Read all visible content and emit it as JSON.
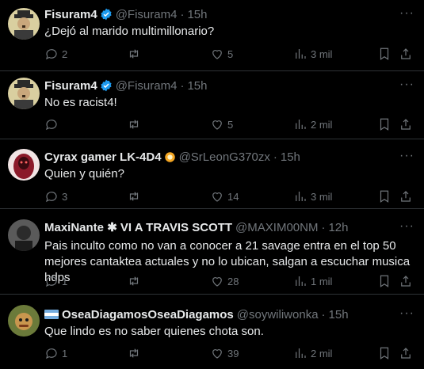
{
  "tweets": [
    {
      "name": "Fisuram4",
      "handle": "@Fisuram4",
      "time": "15h",
      "text": "¿Dejó al marido multimillonario?",
      "verified": true,
      "stats": {
        "replies": "2",
        "retweets": "",
        "likes": "5",
        "views": "3 mil"
      }
    },
    {
      "name": "Fisuram4",
      "handle": "@Fisuram4",
      "time": "15h",
      "text": "No es racist4!",
      "verified": true,
      "stats": {
        "replies": "",
        "retweets": "",
        "likes": "5",
        "views": "2 mil"
      }
    },
    {
      "name": "Cyrax gamer LK-4D4",
      "handle": "@SrLeonG370zx",
      "time": "15h",
      "text": "Quien y quién?",
      "verified": false,
      "stats": {
        "replies": "3",
        "retweets": "",
        "likes": "14",
        "views": "3 mil"
      }
    },
    {
      "name": "MaxiNante ✱ VI A TRAVIS SCOTT",
      "handle": "@MAXIM00NM",
      "time": "12h",
      "text": "Pais inculto como no van a conocer a 21 savage entra en el top 50 mejores cantaktea actuales y no lo ubican, salgan a escuchar musica hdps",
      "verified": false,
      "stats": {
        "replies": "1",
        "retweets": "",
        "likes": "28",
        "views": "1 mil"
      }
    },
    {
      "name": "OseaDiagamosOseaDiagamos",
      "handle": "@soywiliwonka",
      "time": "15h",
      "text": "Que lindo es no saber quienes chota son.",
      "verified": false,
      "stats": {
        "replies": "1",
        "retweets": "",
        "likes": "39",
        "views": "2 mil"
      }
    }
  ],
  "colors": {
    "background": "#000000",
    "text": "#e7e9ea",
    "muted": "#71767b",
    "verified": "#1d9bf0",
    "divider": "#2f3336"
  },
  "icons": [
    "reply-icon",
    "retweet-icon",
    "like-icon",
    "views-icon",
    "bookmark-icon",
    "share-icon",
    "more-icon",
    "verified-icon"
  ]
}
